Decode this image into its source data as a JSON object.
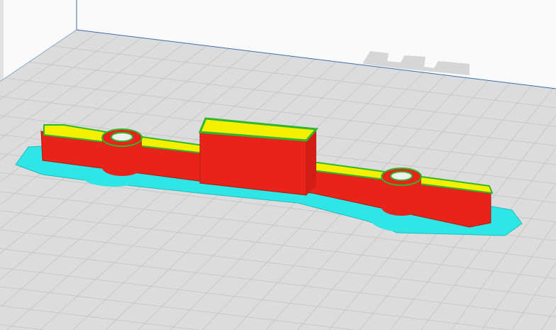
{
  "viewport": {
    "view": "3d-layer-view",
    "colors": {
      "background": "#fafafa",
      "build_plate": "#dcdcdc",
      "grid_line": "#c8c8c8",
      "plate_edge": "#3b6fb0",
      "wall_outer": "#e8231a",
      "top_skin": "#f5f000",
      "inner_wall": "#2db82d",
      "brim": "#2ee6e6",
      "shadow_block": "#d6d6d6"
    }
  }
}
